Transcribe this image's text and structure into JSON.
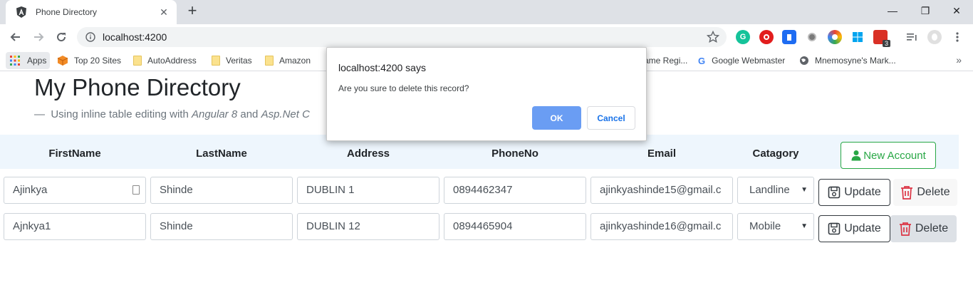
{
  "browser": {
    "tab_title": "Phone Directory",
    "tab_close": "✕",
    "new_tab": "+",
    "url": "localhost:4200",
    "window_controls": {
      "minimize": "—",
      "restore": "❐",
      "close": "✕"
    }
  },
  "bookmarks": {
    "apps": "Apps",
    "items": [
      "Top 20 Sites",
      "AutoAddress",
      "Veritas",
      "Amazon",
      "ame Regi...",
      "Google Webmaster",
      "Mnemosyne's Mark..."
    ],
    "more": "»"
  },
  "extensions": {
    "badge_count": "3"
  },
  "page": {
    "title": "My Phone Directory",
    "lead_dash": "—",
    "lead_prefix": "Using inline table editing with",
    "lead_angular": "Angular 8",
    "lead_and": "and",
    "lead_aspnet": "Asp.Net C"
  },
  "table": {
    "headers": [
      "FirstName",
      "LastName",
      "Address",
      "PhoneNo",
      "Email",
      "Catagory"
    ],
    "new_account_label": "New Account",
    "update_label": "Update",
    "delete_label": "Delete",
    "rows": [
      {
        "first": "Ajinkya",
        "last": "Shinde",
        "address": "DUBLIN 1",
        "phone": "0894462347",
        "email": "ajinkyashinde15@gmail.c",
        "category": "Landline"
      },
      {
        "first": "Ajnkya1",
        "last": "Shinde",
        "address": "DUBLIN 12",
        "phone": "0894465904",
        "email": "ajinkyashinde16@gmail.c",
        "category": "Mobile"
      }
    ]
  },
  "dialog": {
    "title": "localhost:4200 says",
    "message": "Are you sure to delete this record?",
    "ok": "OK",
    "cancel": "Cancel"
  },
  "colors": {
    "success": "#28a745",
    "danger": "#dc3545",
    "header_bg": "#eef6fd",
    "ok_button": "#6a9df3"
  }
}
